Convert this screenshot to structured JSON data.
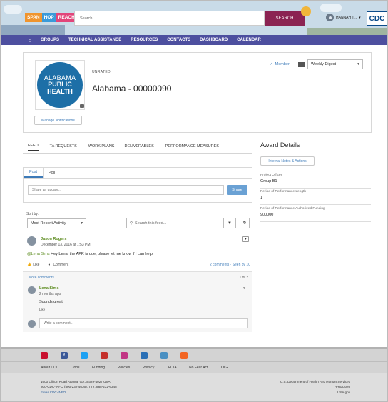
{
  "header": {
    "logo_parts": [
      "SPAN",
      "HOP",
      "REACH"
    ],
    "search_placeholder": "Search...",
    "search_button": "SEARCH",
    "user_name": "HANNAH T...",
    "cdc_logo": "CDC"
  },
  "nav": {
    "items": [
      "GROUPS",
      "TECHNICAL ASSISTANCE",
      "RESOURCES",
      "CONTACTS",
      "DASHBOARD",
      "CALENDAR"
    ]
  },
  "account": {
    "logo_lines": [
      "ALABAMA",
      "PUBLIC",
      "HEALTH"
    ],
    "rating": "UNRATED",
    "name": "Alabama - 00000090",
    "manage_button": "Manage Notifications",
    "member_label": "Member",
    "digest_select": "Weekly Digest"
  },
  "tabs": [
    "FEED",
    "TA REQUESTS",
    "WORK PLANS",
    "DELIVERABLES",
    "PERFORMANCE MEASURES"
  ],
  "publisher": {
    "tabs": [
      "Post",
      "Poll"
    ],
    "input_placeholder": "Share an update...",
    "share_button": "Share"
  },
  "feed": {
    "sort_label": "Sort by:",
    "sort_value": "Most Recent Activity",
    "search_placeholder": "Search this feed..."
  },
  "post": {
    "author": "Jason Rogers",
    "date": "December 13, 2016 at 1:53 PM",
    "mention": "@Lena Sims",
    "body": "Hey Lena, the APR is due, please let me know if I can help.",
    "like": "Like",
    "comment": "Comment",
    "stats": "2 comments · Seen by 10"
  },
  "comments": {
    "more": "More comments",
    "count": "1 of 2",
    "author": "Lena Sims",
    "time": "2 months ago",
    "body": "Sounds great!",
    "like": "Like",
    "write_placeholder": "Write a comment..."
  },
  "award": {
    "title": "Award Details",
    "notes_button": "Internal Notes & Actions",
    "fields": [
      {
        "label": "Project Officer",
        "value": "Group B1"
      },
      {
        "label": "Period of Performance Length",
        "value": "1"
      },
      {
        "label": "Period of Performance Authorized Funding",
        "value": "900000"
      }
    ]
  },
  "footer": {
    "links": [
      "About CDC",
      "Jobs",
      "Funding",
      "Policies",
      "Privacy",
      "FOIA",
      "No Fear Act",
      "OIG"
    ],
    "address_lines": [
      "1600 Clifton Road Atlanta, GA 30329-4027 USA",
      "800-CDC-INFO (800-232-4636), TTY: 888-232-6348"
    ],
    "email_link": "Email CDC-INFO",
    "agency_lines": [
      "U.S. Department of Health And Human Services",
      "HHS/Open",
      "USA.gov"
    ],
    "social_colors": [
      "#c8102e",
      "#3b5998",
      "#1da1f2",
      "#c4302b",
      "#c13584",
      "#2a6fb5",
      "#4a90c2",
      "#f26522"
    ]
  }
}
